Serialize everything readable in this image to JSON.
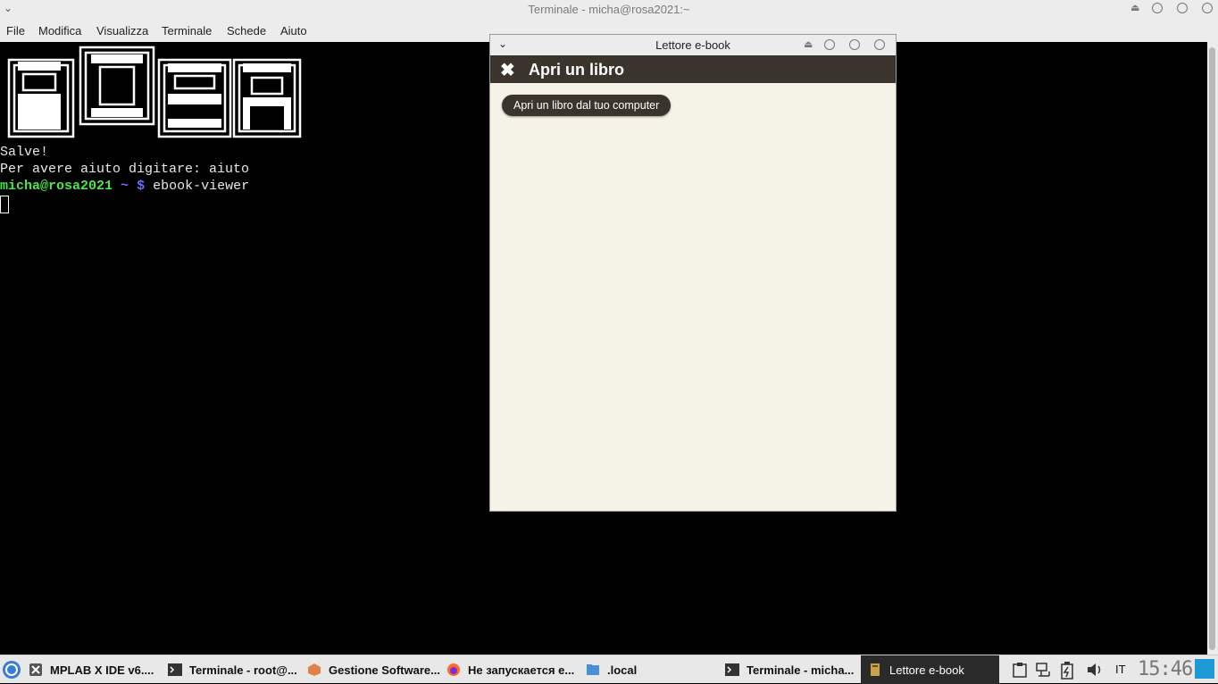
{
  "terminal_window": {
    "title": "Terminale - micha@rosa2021:~",
    "menu": [
      "File",
      "Modifica",
      "Visualizza",
      "Terminale",
      "Schede",
      "Aiuto"
    ]
  },
  "terminal": {
    "logo_text": "ROSA",
    "line1": "Salve!",
    "line2": "Per avere aiuto digitare: aiuto",
    "prompt_user": "micha@rosa2021",
    "prompt_path": "~",
    "prompt_symbol": "$",
    "command": "ebook-viewer"
  },
  "ebook_window": {
    "title": "Lettore e-book",
    "header_title": "Apri un libro",
    "open_button": "Apri un libro dal tuo computer"
  },
  "taskbar": {
    "items": [
      {
        "label": "MPLAB X IDE v6....",
        "icon": "mplab-icon"
      },
      {
        "label": "Terminale - root@...",
        "icon": "terminal-icon"
      },
      {
        "label": "Gestione Software...",
        "icon": "package-icon"
      },
      {
        "label": "Не запускается e...",
        "icon": "firefox-icon"
      },
      {
        "label": ".local",
        "icon": "folder-icon"
      },
      {
        "label": "Terminale - micha...",
        "icon": "terminal-icon"
      },
      {
        "label": "Lettore e-book",
        "icon": "ebook-icon"
      }
    ],
    "keyboard_layout": "IT",
    "clock": "15:46"
  },
  "colors": {
    "ebook_header": "#3b342d",
    "ebook_background": "#f5f2e7",
    "prompt_user": "#4ee44e",
    "prompt_symbol": "#6b6bff"
  }
}
